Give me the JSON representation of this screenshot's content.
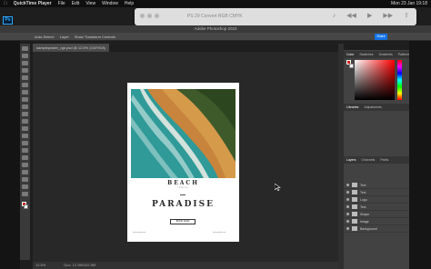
{
  "mac_menu": {
    "app": "QuickTime Player",
    "items": [
      "File",
      "Edit",
      "View",
      "Window",
      "Help"
    ],
    "clock": "Mon 23 Jan 19:18"
  },
  "quicktime": {
    "title": "PS 29 Convert RGB CMYK"
  },
  "photoshop": {
    "logo": "Ps",
    "window_title": "Adobe Photoshop 2023",
    "menu_items": [
      "Photoshop",
      "File",
      "Edit",
      "Image",
      "Layer",
      "Type",
      "Select",
      "Filter",
      "3D",
      "View",
      "Plugins",
      "Window",
      "Help"
    ],
    "options_auto_select": "Auto-Select:",
    "options_layer": "Layer",
    "options_show_transform": "Show Transform Controls",
    "share_label": "Share",
    "doc_tab": "sampleposter_rgb.psd @ 12.5% (CMYK/8)",
    "status_zoom": "12.5%",
    "status_doc": "Doc: 12.0M/102.9M"
  },
  "poster": {
    "title": "BEACH",
    "subtitle": "TRAVEL",
    "headline": "PARADISE",
    "button": "BOOK NOW",
    "footer_left": "www.website.com",
    "footer_right": "www.website.com"
  },
  "panels": {
    "color_tabs": [
      "Color",
      "Swatches",
      "Gradients",
      "Patterns"
    ],
    "library_tabs": [
      "Libraries",
      "Adjustments"
    ],
    "layer_tabs": [
      "Layers",
      "Channels",
      "Paths"
    ],
    "layers": [
      {
        "name": "Text"
      },
      {
        "name": "Text"
      },
      {
        "name": "Logo"
      },
      {
        "name": "Text"
      },
      {
        "name": "Shape"
      },
      {
        "name": "Image"
      },
      {
        "name": "Background"
      }
    ]
  },
  "colors": {
    "accent": "#1473e6",
    "foreground": "#d4211a"
  }
}
